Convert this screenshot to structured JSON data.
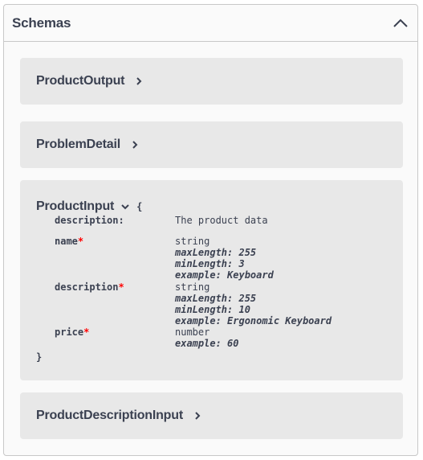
{
  "section": {
    "title": "Schemas",
    "collapse_icon": "chevron-up-icon"
  },
  "models": [
    {
      "name": "ProductOutput",
      "expanded": false
    },
    {
      "name": "ProblemDetail",
      "expanded": false
    },
    {
      "name": "ProductInput",
      "expanded": true,
      "open_brace": "{",
      "close_brace": "}",
      "description_label": "description:",
      "description_value": "The product data",
      "properties": [
        {
          "name": "name",
          "required_mark": "*",
          "type": "string",
          "constraints": [
            "maxLength: 255",
            "minLength: 3",
            "example: Keyboard"
          ]
        },
        {
          "name": "description",
          "required_mark": "*",
          "type": "string",
          "constraints": [
            "maxLength: 255",
            "minLength: 10",
            "example: Ergonomic Keyboard"
          ]
        },
        {
          "name": "price",
          "required_mark": "*",
          "type": "number",
          "constraints": [
            "example: 60"
          ]
        }
      ]
    },
    {
      "name": "ProductDescriptionInput",
      "expanded": false
    }
  ]
}
